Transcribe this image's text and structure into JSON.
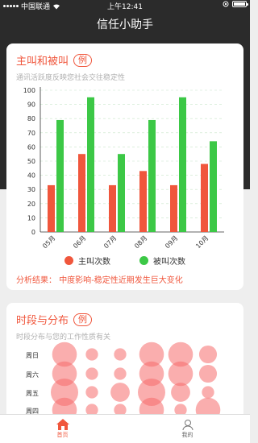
{
  "status_bar": {
    "carrier": "中国联通",
    "time": "上午12:41"
  },
  "header": {
    "title": "信任小助手"
  },
  "card1": {
    "title": "主叫和被叫",
    "tag": "例",
    "subtitle": "通讯活跃度反映您社会交往稳定性",
    "legend": {
      "caller": "主叫次数",
      "callee": "被叫次数"
    },
    "analysis_label": "分析结果：",
    "analysis_level": "中度影响",
    "analysis_sep": "-",
    "analysis_text": "稳定性近期发生巨大变化"
  },
  "card2": {
    "title": "时段与分布",
    "tag": "例",
    "subtitle": "时段分布与您的工作性质有关",
    "days": [
      "周日",
      "周六",
      "周五",
      "周四"
    ]
  },
  "tabbar": {
    "home": "首页",
    "mine": "我的"
  },
  "colors": {
    "caller": "#f0563c",
    "callee": "#3cc846",
    "accent": "#f0563c"
  },
  "chart_data": {
    "type": "bar",
    "categories": [
      "05月",
      "06月",
      "07月",
      "08月",
      "09月",
      "10月"
    ],
    "series": [
      {
        "name": "主叫次数",
        "values": [
          33,
          55,
          33,
          43,
          33,
          48
        ]
      },
      {
        "name": "被叫次数",
        "values": [
          79,
          95,
          55,
          79,
          95,
          64
        ]
      }
    ],
    "ylim": [
      0,
      100
    ],
    "yticks": [
      0,
      10,
      20,
      30,
      40,
      50,
      60,
      70,
      80,
      90,
      100
    ],
    "grid": true,
    "legend": "bottom"
  },
  "bubble_data": {
    "rows": [
      "周日",
      "周六",
      "周五",
      "周四"
    ],
    "columns": 6,
    "sizes": [
      [
        0.9,
        0.45,
        0.45,
        0.9,
        0.9,
        0.65
      ],
      [
        0.9,
        0.45,
        0.45,
        0.9,
        0.9,
        0.65
      ],
      [
        1.0,
        0.45,
        0.7,
        1.0,
        0.7,
        0.45
      ],
      [
        0.9,
        0.45,
        0.45,
        0.9,
        0.45,
        0.9
      ]
    ]
  }
}
